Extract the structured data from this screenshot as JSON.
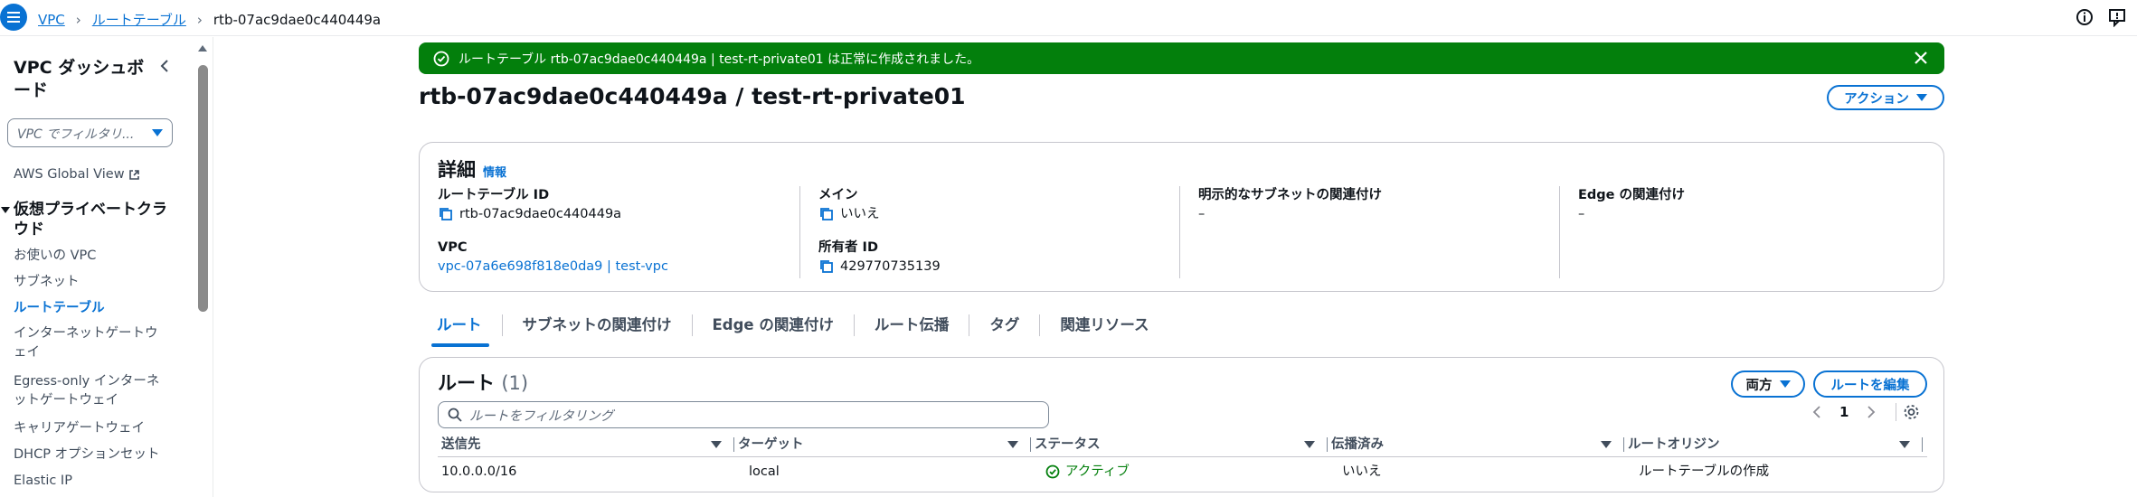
{
  "breadcrumb": {
    "items": [
      "VPC",
      "ルートテーブル"
    ],
    "current": "rtb-07ac9dae0c440449a"
  },
  "sidebar": {
    "title": "VPC ダッシュボード",
    "filter_placeholder": "VPC でフィルタリ...",
    "global_view": "AWS Global View",
    "section": "仮想プライベートクラウド",
    "items": [
      "お使いの VPC",
      "サブネット",
      "ルートテーブル",
      "インターネットゲートウェイ",
      "Egress-only インターネットゲートウェイ",
      "キャリアゲートウェイ",
      "DHCP オプションセット",
      "Elastic IP"
    ],
    "active_index": 2
  },
  "flash": {
    "message": "ルートテーブル rtb-07ac9dae0c440449a | test-rt-private01 は正常に作成されました。",
    "color": "#037f0c"
  },
  "page": {
    "title": "rtb-07ac9dae0c440449a / test-rt-private01",
    "actions_label": "アクション"
  },
  "details": {
    "heading": "詳細",
    "info_label": "情報",
    "route_table_id_label": "ルートテーブル ID",
    "route_table_id": "rtb-07ac9dae0c440449a",
    "main_label": "メイン",
    "main_value": "いいえ",
    "explicit_subnet_label": "明示的なサブネットの関連付け",
    "explicit_subnet_value": "–",
    "edge_label": "Edge の関連付け",
    "edge_value": "–",
    "vpc_label": "VPC",
    "vpc_value": "vpc-07a6e698f818e0da9 | test-vpc",
    "owner_label": "所有者 ID",
    "owner_value": "429770735139"
  },
  "tabs": [
    "ルート",
    "サブネットの関連付け",
    "Edge の関連付け",
    "ルート伝播",
    "タグ",
    "関連リソース"
  ],
  "routes": {
    "title": "ルート",
    "count": "(1)",
    "both_label": "両方",
    "edit_label": "ルートを編集",
    "search_placeholder": "ルートをフィルタリング",
    "page_number": "1",
    "columns": [
      "送信先",
      "ターゲット",
      "ステータス",
      "伝播済み",
      "ルートオリジン"
    ],
    "rows": [
      [
        "10.0.0.0/16",
        "local",
        "アクティブ",
        "いいえ",
        "ルートテーブルの作成"
      ]
    ]
  },
  "colors": {
    "accent": "#0972d3",
    "success": "#037f0c"
  }
}
